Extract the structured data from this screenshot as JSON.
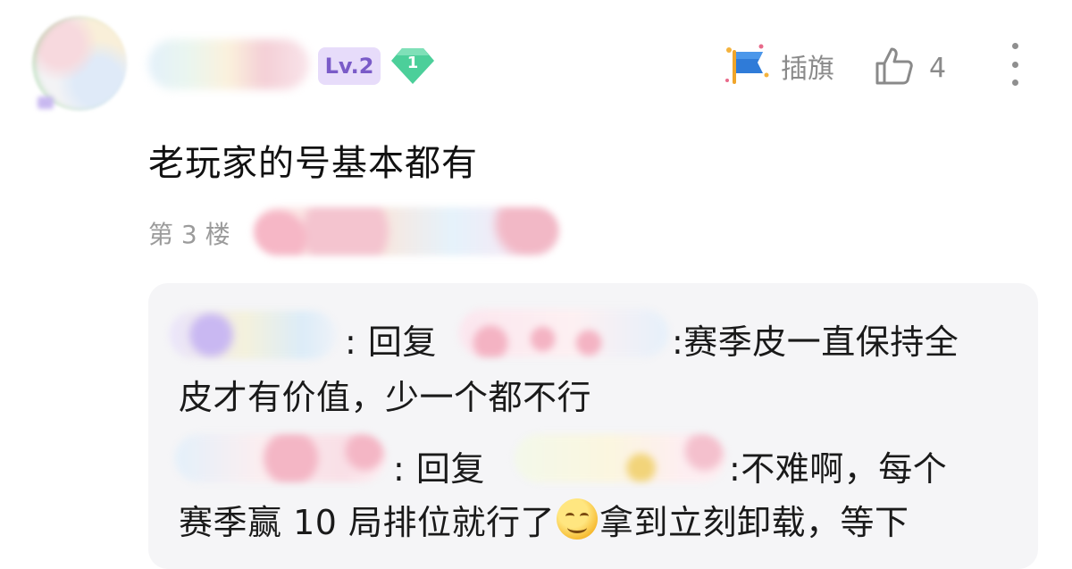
{
  "comment": {
    "level": "Lv.2",
    "gem_number": "1",
    "flag_label": "插旗",
    "like_count": "4",
    "text": "老玩家的号基本都有",
    "floor": "第 3 楼"
  },
  "replies": {
    "reply_word": "回复",
    "r1_line1": ":赛季皮一直保持全",
    "r1_line2": "皮才有价值，少一个都不行",
    "r2_line1": ":不难啊，每个",
    "r2_line2_a": "赛季赢 10 局排位就行了",
    "r2_line2_b": "拿到立刻卸载，等下"
  },
  "colors": {
    "level_bg": "#e7dcfa",
    "level_text": "#7a5bc8",
    "gem": "#4ccf9a",
    "flag_blue": "#2f7bd8",
    "muted": "#8a8a8a",
    "reply_bg": "#f5f5f7"
  },
  "icons": [
    "flag-icon",
    "thumbs-up-icon",
    "more-vertical-icon",
    "gem-badge-icon",
    "grin-emoji-icon"
  ]
}
